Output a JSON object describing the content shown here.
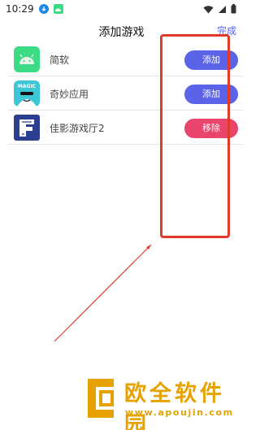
{
  "status_bar": {
    "time": "10:29",
    "icons_left": [
      "download-icon",
      "android-notification-icon"
    ],
    "icons_right": [
      "wifi-icon",
      "signal-icon",
      "battery-icon"
    ]
  },
  "header": {
    "title": "添加游戏",
    "done_label": "完成"
  },
  "apps": [
    {
      "name": "简软",
      "icon": "android-robot-icon",
      "action_label": "添加",
      "action_color": "#5b63e8"
    },
    {
      "name": "奇妙应用",
      "icon": "magic-app-icon",
      "action_label": "添加",
      "action_color": "#5b63e8"
    },
    {
      "name": "佳影游戏厅2",
      "icon": "jiaying-app-icon",
      "action_label": "移除",
      "action_color": "#e8446c"
    }
  ],
  "colors": {
    "accent": "#5564f5",
    "add_button": "#5b63e8",
    "remove_button": "#e8446c",
    "annotation_red": "#e23a2a",
    "watermark": "#e6a200"
  },
  "watermark": {
    "brand": "欧全软件园",
    "url": "www.apoujin.com"
  }
}
